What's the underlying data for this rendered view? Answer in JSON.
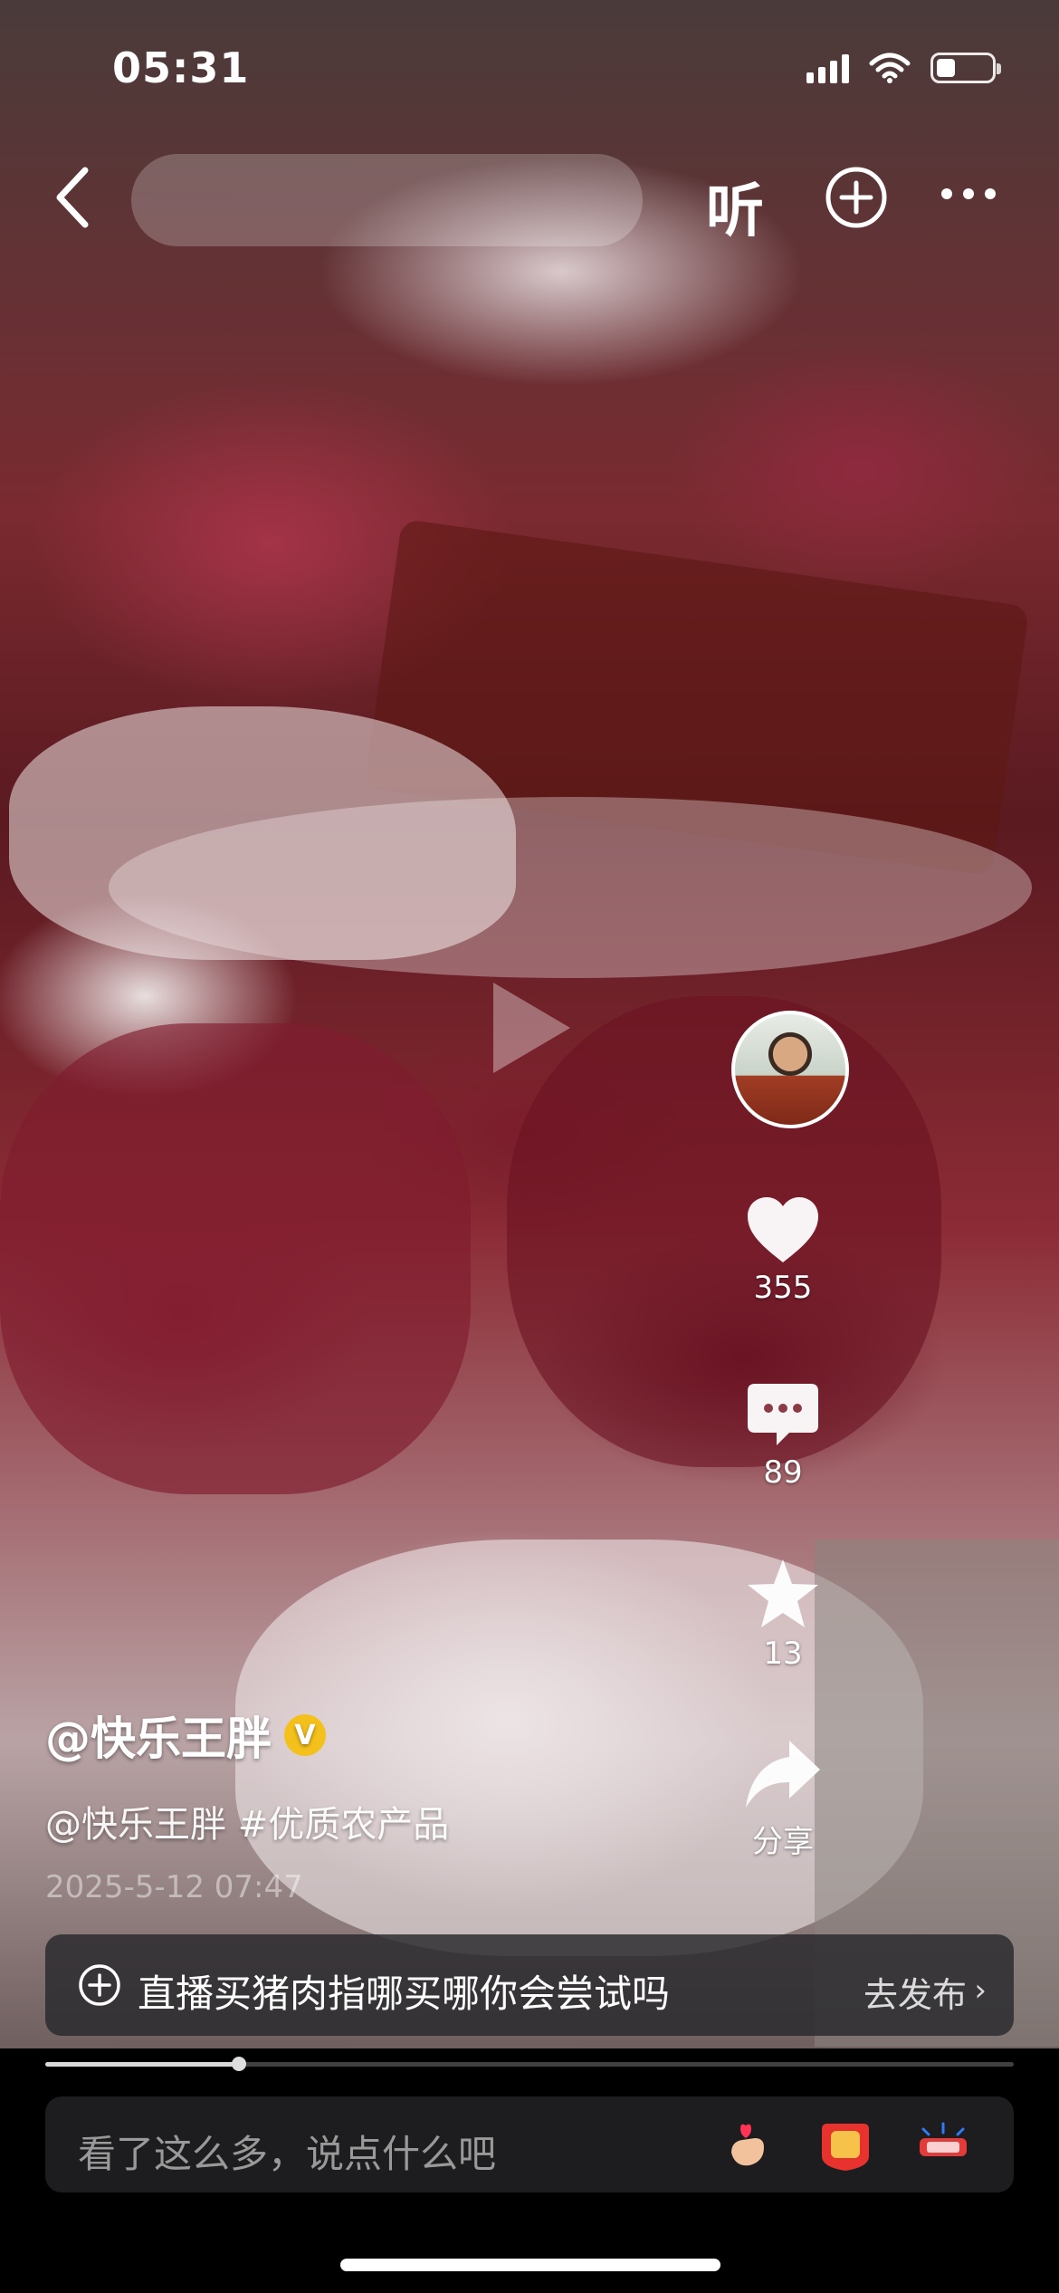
{
  "status": {
    "time": "05:31",
    "battery_percent": 35
  },
  "nav": {
    "listen_label": "听"
  },
  "stats": {
    "likes": "355",
    "comments": "89",
    "favorites": "13",
    "share_label": "分享"
  },
  "caption": {
    "author": "@快乐王胖",
    "verified_badge": "V",
    "description": "@快乐王胖 #优质农产品",
    "date": "2025-5-12 07:47"
  },
  "topic": {
    "text": "直播买猪肉指哪买哪你会尝试吗",
    "action": "去发布",
    "chevron": "›"
  },
  "playback": {
    "progress_fraction": 0.2
  },
  "comment": {
    "placeholder": "看了这么多，说点什么吧"
  },
  "icons": {
    "back": "chevron-left-icon",
    "plus": "plus-circle-icon",
    "more": "more-icon",
    "like": "heart-icon",
    "comment": "comment-icon",
    "favorite": "star-icon",
    "share": "share-icon"
  }
}
